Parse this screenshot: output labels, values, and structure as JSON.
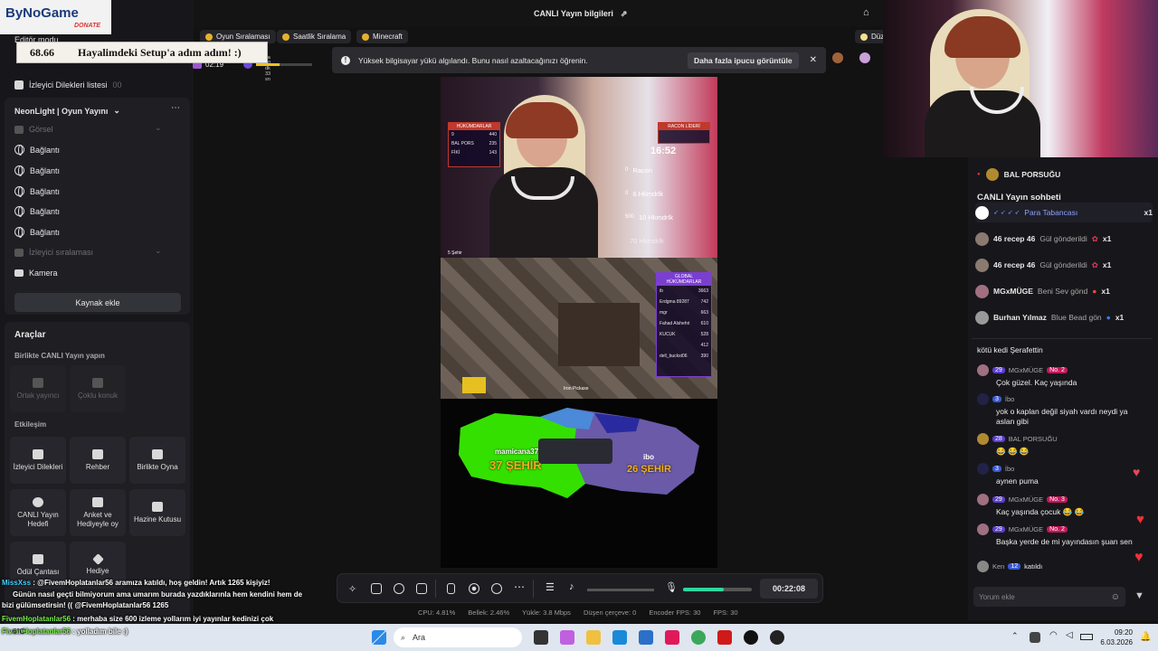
{
  "logo": {
    "name": "ByNoGame",
    "tag": "DONATE"
  },
  "donation_banner": {
    "amount": "68.66",
    "text": "Hayalimdeki Setup'a adım adım! :)"
  },
  "left_panel": {
    "editor_mode": "Editör modu",
    "viewer_wishlist": "İzleyici Dilekleri listesi",
    "viewer_wishlist_count": "00",
    "scene_name": "NeonLight | Oyun Yayını",
    "visual_label": "Görsel",
    "links": [
      "Bağlantı",
      "Bağlantı",
      "Bağlantı",
      "Bağlantı",
      "Bağlantı"
    ],
    "viewer_ranking": "İzleyici sıralaması",
    "camera": "Kamera",
    "add_source": "Kaynak ekle",
    "tools_title": "Araçlar",
    "live_together": "Birlikte CANLI Yayın yapın",
    "co_host": "Ortak yayıncı",
    "multi_guest": "Çoklu konuk",
    "interaction": "Etkileşim",
    "tiles": [
      "İzleyici Dilekleri",
      "Rehber",
      "Birlikte Oyna",
      "CANLI Yayın Hedefi",
      "Anket ve Hediyeyle oy",
      "Hazine Kutusu",
      "Ödül Çantası",
      "Hediye"
    ],
    "timer": "02:19",
    "timer_small": "2 sa 40 dk 33 sn"
  },
  "topbar": {
    "title": "CANLI Yayın bilgileri",
    "pills": [
      "Oyun Sıralaması",
      "Saatlik Sıralama",
      "Minecraft"
    ],
    "right_label": "Düz"
  },
  "notification": {
    "text": "Yüksek bilgisayar yükü algılandı. Bunu nasıl azaltacağınızı öğrenin.",
    "action": "Daha fazla ipucu görüntüle"
  },
  "preview": {
    "clock": "16:52",
    "gifts": [
      {
        "name": "Racon",
        "count": "0"
      },
      {
        "name": "6 Hkmdrlk",
        "count": "0"
      },
      {
        "name": "10 Hkmdrlk",
        "count": "500"
      },
      {
        "name": "70 Hkmdrlk",
        "count": ""
      }
    ],
    "map_left_name": "mamicana37",
    "map_left_count": "37 ŞEHİR",
    "map_right_name": "ibo",
    "map_right_count": "26 ŞEHİR",
    "left_board_title": "HÜKÜMDARLAR",
    "left_board": [
      {
        "n": "9",
        "v": "440"
      },
      {
        "n": "BAL PORS",
        "v": "235"
      },
      {
        "n": "FİKİ",
        "v": "143"
      }
    ],
    "racon_board_title": "RACON LİDERİ",
    "global_board_title": "GLOBAL HÜKÜMDARLAR",
    "global_board": [
      {
        "n": "ib",
        "v": "3663"
      },
      {
        "n": "Erdgma 89287",
        "v": "742"
      },
      {
        "n": "mgr",
        "v": "663"
      },
      {
        "n": "Fahad Alshehri",
        "v": "610"
      },
      {
        "n": "KUCUK",
        "v": "528"
      },
      {
        "n": "",
        "v": "412"
      },
      {
        "n": "dell_buckst06",
        "v": "390"
      }
    ],
    "city_label": "5 Şehir",
    "item_label": "Iron Pickaxe"
  },
  "toolbar": {
    "timer": "00:22:08"
  },
  "stats": [
    "CPU: 4.81%",
    "Bellek: 2.46%",
    "Yükle: 3.8 Mbps",
    "Düşen çerçeve: 0",
    "Encoder FPS: 30",
    "FPS: 30"
  ],
  "chat": {
    "top_user": "BAL PORSUĞU",
    "title": "CANLI Yayın sohbeti",
    "gifts": [
      {
        "user": "",
        "gift": "Para Tabancası",
        "count": "x1"
      },
      {
        "user": "46 recep 46",
        "gift": "Gül gönderildi",
        "count": "x1"
      },
      {
        "user": "46 recep 46",
        "gift": "Gül gönderildi",
        "count": "x1"
      },
      {
        "user": "MGxMÜGE",
        "gift": "Beni Sev gönd",
        "count": "x1"
      },
      {
        "user": "Burhan Yılmaz",
        "gift": "Blue Bead gön",
        "count": "x1"
      }
    ],
    "messages": [
      {
        "level": "",
        "user": "",
        "badge": "",
        "text": "kötü kedi Şerafettin"
      },
      {
        "level": "29",
        "user": "MGxMÜGE",
        "badge": "No. 2",
        "text": "Çok güzel. Kaç yaşında"
      },
      {
        "level": "3",
        "user": "İbo",
        "badge": "",
        "text": "yok o kaplan değil siyah vardı neydi ya aslan gibi"
      },
      {
        "level": "28",
        "user": "BAL PORSUĞU",
        "badge": "",
        "text": "😂 😂 😂"
      },
      {
        "level": "3",
        "user": "İbo",
        "badge": "",
        "text": "aynen puma"
      },
      {
        "level": "29",
        "user": "MGxMÜGE",
        "badge": "No. 3",
        "text": "Kaç yaşında çocuk 😂 😂"
      },
      {
        "level": "29",
        "user": "MGxMÜGE",
        "badge": "No. 2",
        "text": "Başka yerde de mi yayındasın şuan sen"
      },
      {
        "level": "12",
        "user": "Ken",
        "badge": "",
        "text": "katıldı"
      }
    ],
    "input_placeholder": "Yorum ekle"
  },
  "overlay_chat": [
    {
      "user": "MissXss",
      "text": ": @FivemHoplatanlar56 aramıza katıldı, hoş geldin! Artık 1265 kişiyiz!"
    },
    {
      "user": "",
      "text": "Günün nasıl geçti bilmiyorum ama umarım burada yazdıklarınla hem kendini hem de"
    },
    {
      "user": "",
      "text": "bizi gülümsetirsin! (( @FivemHoplatanlar56 1265"
    },
    {
      "user": "FivemHoplatanlar56",
      "text": ": merhaba size 600 izleme yollarım iyi yayınlar kedinizi çok"
    },
    {
      "user": "FivemHoplatanlar56",
      "text": ": yolladım bile :)"
    }
  ],
  "weather": "6°C",
  "taskbar": {
    "search": "Ara",
    "time": "09:20",
    "date": "6.03.2026"
  }
}
